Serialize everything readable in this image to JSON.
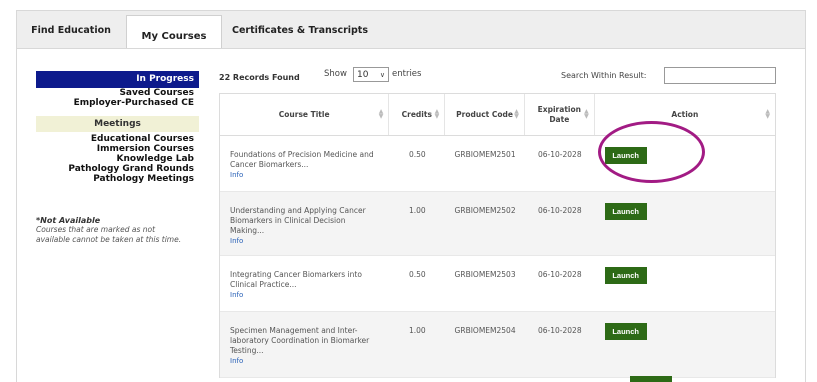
{
  "tabs": [
    {
      "label": "Find Education",
      "active": false
    },
    {
      "label": "My Courses",
      "active": true
    },
    {
      "label": "Certificates & Transcripts",
      "active": false
    }
  ],
  "sidebar": {
    "in_progress": "In Progress",
    "links_top": [
      "Saved Courses",
      "Employer-Purchased CE"
    ],
    "meetings_header": "Meetings",
    "links_bottom": [
      "Educational Courses",
      "Immersion Courses",
      "Knowledge Lab",
      "Pathology Grand Rounds",
      "Pathology Meetings"
    ],
    "not_available_title": "*Not Available",
    "not_available_text": "Courses that are marked as not available cannot be taken at this time."
  },
  "toolbar": {
    "records_found": "22 Records Found",
    "show_label": "Show",
    "show_value": "10",
    "entries_label": "entries",
    "search_label": "Search Within Result:",
    "search_value": ""
  },
  "table": {
    "headers": [
      "Course Title",
      "Credits",
      "Product Code",
      "Expiration Date",
      "Action"
    ],
    "rows": [
      {
        "title": "Foundations of Precision Medicine and Cancer Biomarkers...",
        "info": "Info",
        "credits": "0.50",
        "code": "GRBIOMEM2501",
        "expiration": "06-10-2028",
        "action": "Launch"
      },
      {
        "title": "Understanding and Applying Cancer Biomarkers in Clinical Decision Making...",
        "info": "Info",
        "credits": "1.00",
        "code": "GRBIOMEM2502",
        "expiration": "06-10-2028",
        "action": "Launch"
      },
      {
        "title": "Integrating Cancer Biomarkers into Clinical Practice...",
        "info": "Info",
        "credits": "0.50",
        "code": "GRBIOMEM2503",
        "expiration": "06-10-2028",
        "action": "Launch"
      },
      {
        "title": "Specimen Management and Inter-laboratory Coordination in Biomarker Testing...",
        "info": "Info",
        "credits": "1.00",
        "code": "GRBIOMEM2504",
        "expiration": "06-10-2028",
        "action": "Launch"
      }
    ]
  },
  "colors": {
    "in_progress_bg": "#0d1a8c",
    "meetings_bg": "#f1f1d6",
    "launch_button": "#2d6a16",
    "highlight_circle": "#a21b84",
    "info_link": "#2a62b8"
  }
}
